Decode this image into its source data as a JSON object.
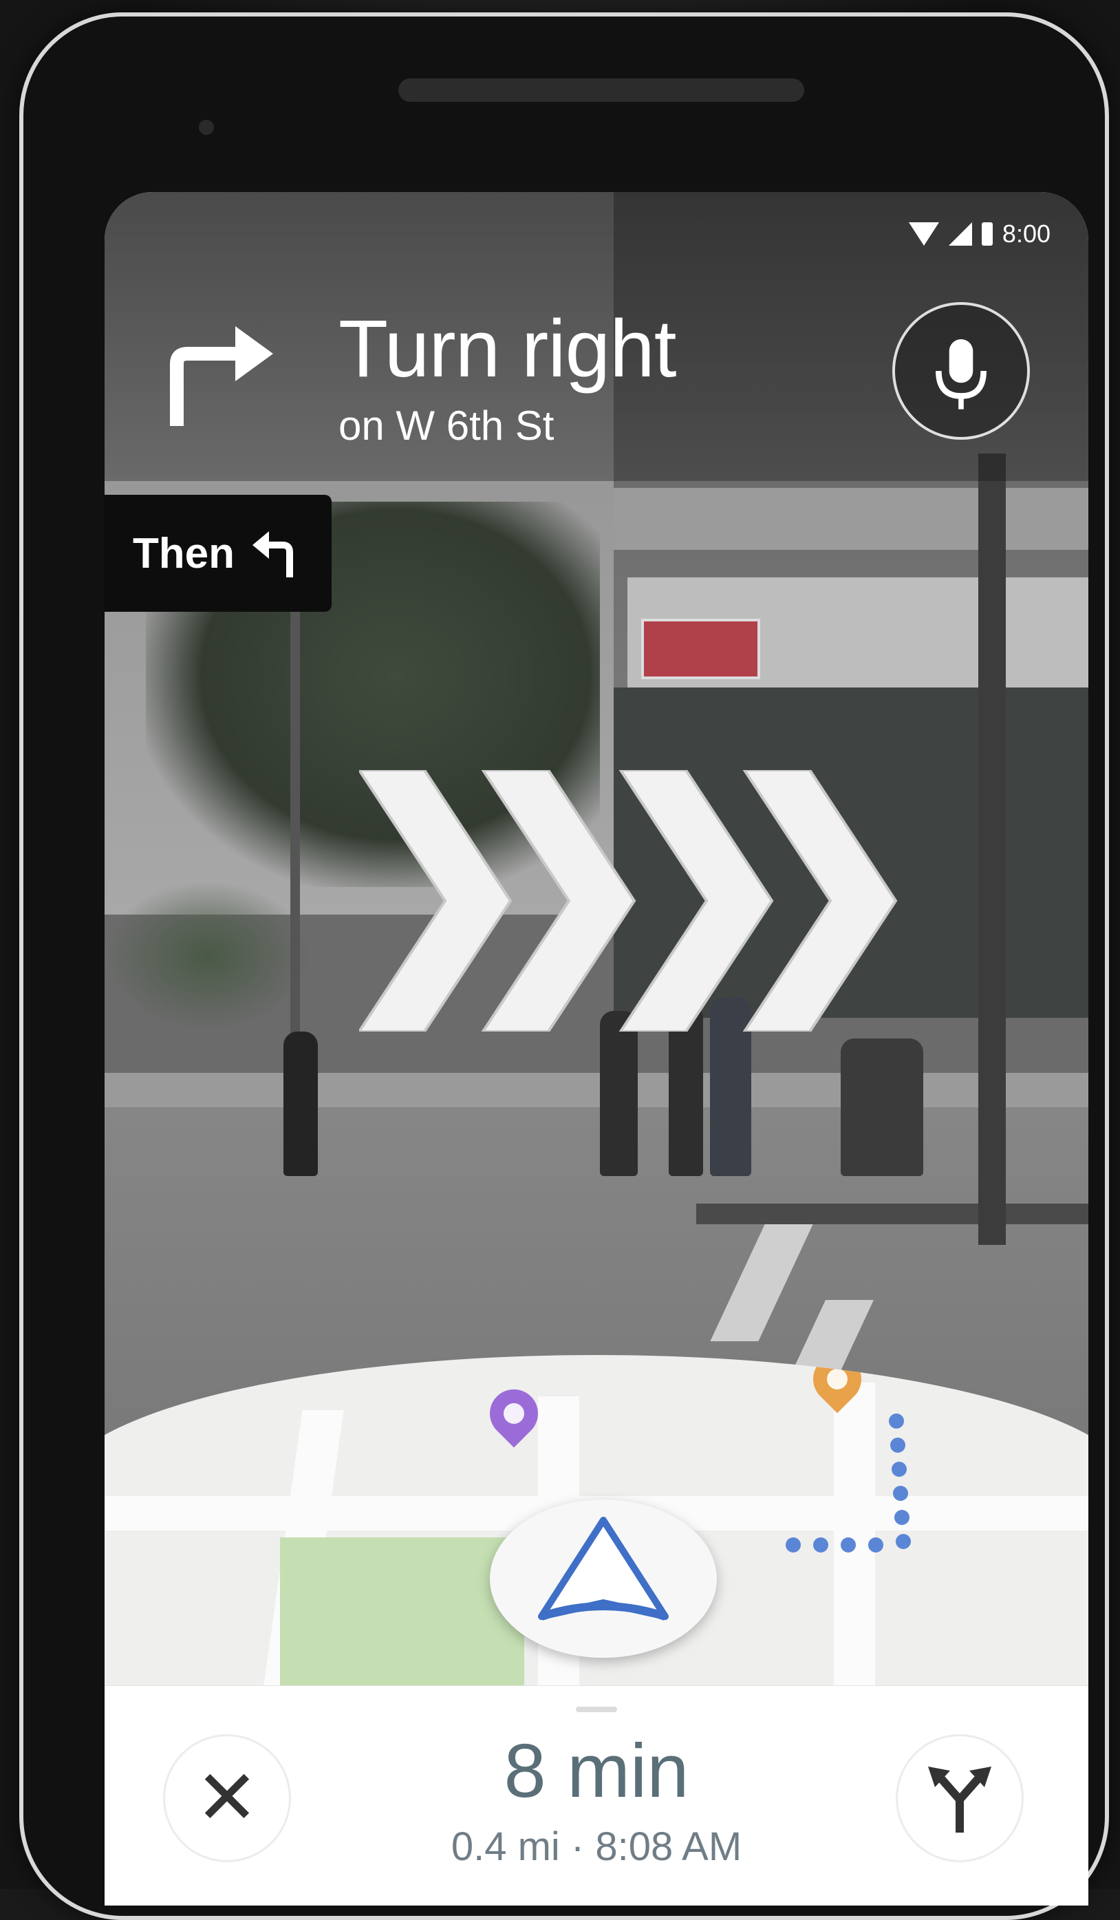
{
  "status_bar": {
    "time": "8:00",
    "icons": [
      "wifi-icon",
      "signal-icon",
      "battery-icon"
    ]
  },
  "navigation": {
    "instruction": "Turn right",
    "street": "on W 6th St",
    "maneuver_icon": "turn-right-icon",
    "then_label": "Then",
    "then_icon": "turn-left-icon",
    "mic_icon": "microphone-icon"
  },
  "map": {
    "poi_icons": [
      "shopping-bag-pin-icon",
      "restaurant-pin-icon"
    ],
    "route_color": "#5b86d6",
    "park_color": "#c5dfb3"
  },
  "trip": {
    "eta_duration": "8 min",
    "distance": "0.4 mi",
    "separator": "·",
    "arrival_time": "8:08 AM",
    "close_icon": "close-icon",
    "close_glyph": "✕",
    "routes_icon": "alternate-routes-icon"
  },
  "colors": {
    "accent_blue": "#3f6fc6",
    "text_gray": "#5a6f78"
  }
}
